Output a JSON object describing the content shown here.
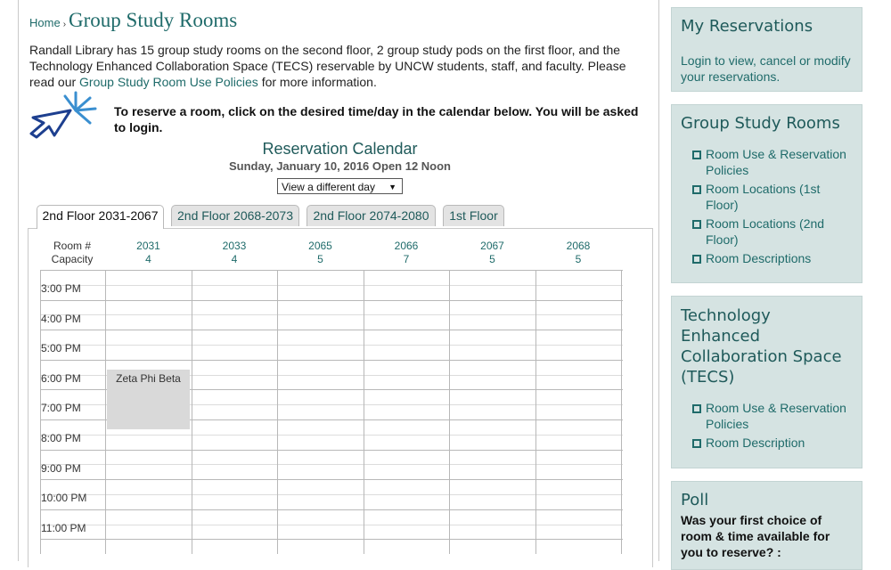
{
  "breadcrumb": {
    "home": "Home",
    "separator": "›",
    "title": "Group Study Rooms"
  },
  "intro": {
    "text_before": "Randall Library has 15 group study rooms on the second floor, 2 group study pods on the first floor, and the Technology Enhanced Collaboration Space (TECS) reservable by UNCW students, staff, and faculty. Please read our ",
    "link": "Group Study Room Use Policies",
    "text_after": " for more information."
  },
  "instruction": "To reserve a room, click on the desired time/day in the calendar below. You will be asked to login.",
  "calendar": {
    "title": "Reservation Calendar",
    "date_line": "Sunday, January 10, 2016  Open 12 Noon",
    "day_select": "View a different day",
    "tabs": [
      "2nd Floor 2031-2067",
      "2nd Floor 2068-2073",
      "2nd Floor 2074-2080",
      "1st Floor"
    ],
    "header_labels": {
      "room": "Room #",
      "capacity": "Capacity"
    },
    "rooms": [
      {
        "number": "2031",
        "capacity": "4"
      },
      {
        "number": "2033",
        "capacity": "4"
      },
      {
        "number": "2065",
        "capacity": "5"
      },
      {
        "number": "2066",
        "capacity": "7"
      },
      {
        "number": "2067",
        "capacity": "5"
      },
      {
        "number": "2068",
        "capacity": "5"
      }
    ],
    "times": [
      "3:00 PM",
      "4:00 PM",
      "5:00 PM",
      "6:00 PM",
      "7:00 PM",
      "8:00 PM",
      "9:00 PM",
      "10:00 PM",
      "11:00 PM"
    ],
    "booking": {
      "label": "Zeta Phi Beta",
      "room": "2031",
      "start": "6:00 PM",
      "end": "8:00 PM"
    }
  },
  "sidebar": {
    "reservations": {
      "title": "My Reservations",
      "text": "Login to view, cancel or modify your reservations."
    },
    "group_rooms": {
      "title": "Group Study Rooms",
      "links": [
        "Room Use & Reservation Policies",
        "Room Locations (1st Floor)",
        "Room Locations (2nd Floor)",
        "Room Descriptions"
      ]
    },
    "tecs": {
      "title": "Technology Enhanced Collaboration Space (TECS)",
      "links": [
        "Room Use & Reservation Policies",
        "Room Description"
      ]
    },
    "poll": {
      "title": "Poll",
      "question": "Was your first choice of room & time available for you to reserve? :"
    }
  },
  "colors": {
    "accent": "#1f6b6a",
    "sidebar_bg": "#d5e3e2",
    "booking_bg": "#d9d9d9"
  }
}
